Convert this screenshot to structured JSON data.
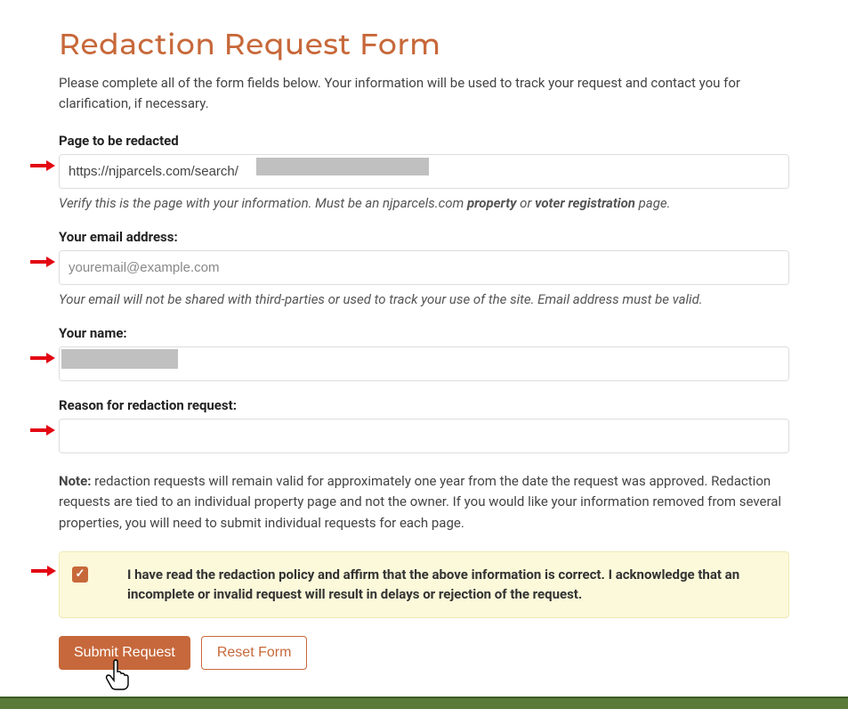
{
  "heading": "Redaction Request Form",
  "intro": "Please complete all of the form fields below. Your information will be used to track your request and contact you for clarification, if necessary.",
  "page_field": {
    "label": "Page to be redacted",
    "value": "https://njparcels.com/search/",
    "help_pre": "Verify this is the page with your information. Must be an njparcels.com ",
    "help_b1": "property",
    "help_mid": " or ",
    "help_b2": "voter registration",
    "help_post": " page."
  },
  "email_field": {
    "label": "Your email address:",
    "placeholder": "youremail@example.com",
    "help": "Your email will not be shared with third-parties or used to track your use of the site. Email address must be valid."
  },
  "name_field": {
    "label": "Your name:",
    "value": ""
  },
  "reason_field": {
    "label": "Reason for redaction request:",
    "value": ""
  },
  "note": {
    "bold": "Note:",
    "text": " redaction requests will remain valid for approximately one year from the date the request was approved. Redaction requests are tied to an individual property page and not the owner. If you would like your information removed from several properties, you will need to submit individual requests for each page."
  },
  "affirm": {
    "checked": true,
    "text": "I have read the redaction policy and affirm that the above information is correct. I acknowledge that an incomplete or invalid request will result in delays or rejection of the request."
  },
  "buttons": {
    "submit": "Submit Request",
    "reset": "Reset Form"
  }
}
